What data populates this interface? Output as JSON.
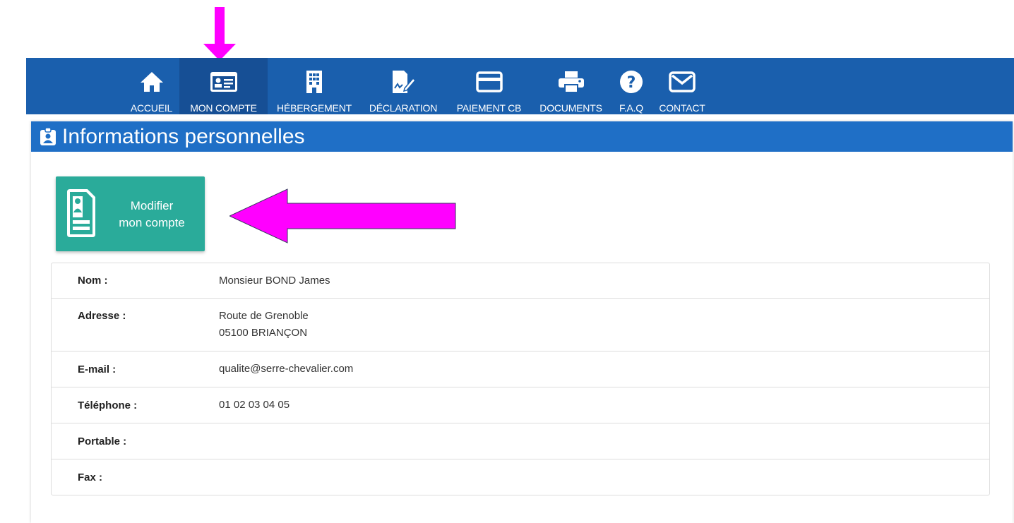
{
  "nav": {
    "items": [
      {
        "label": "ACCUEIL",
        "icon": "home-icon"
      },
      {
        "label": "MON COMPTE",
        "icon": "id-card-icon",
        "active": true
      },
      {
        "label": "HÉBERGEMENT",
        "icon": "building-icon"
      },
      {
        "label": "DÉCLARATION",
        "icon": "signature-icon"
      },
      {
        "label": "PAIEMENT CB",
        "icon": "credit-card-icon"
      },
      {
        "label": "DOCUMENTS",
        "icon": "printer-icon"
      },
      {
        "label": "F.A.Q",
        "icon": "question-icon"
      },
      {
        "label": "CONTACT",
        "icon": "envelope-icon"
      }
    ]
  },
  "panel": {
    "title": "Informations personnelles",
    "modify_button": {
      "line1": "Modifier",
      "line2": "mon compte"
    }
  },
  "info": {
    "rows": [
      {
        "label": "Nom :",
        "lines": [
          "Monsieur BOND James"
        ]
      },
      {
        "label": "Adresse :",
        "lines": [
          "Route de Grenoble",
          "05100 BRIANÇON"
        ]
      },
      {
        "label": "E-mail :",
        "lines": [
          "qualite@serre-chevalier.com"
        ]
      },
      {
        "label": "Téléphone :",
        "lines": [
          "01 02 03 04 05"
        ]
      },
      {
        "label": "Portable :",
        "lines": [
          ""
        ]
      },
      {
        "label": "Fax :",
        "lines": [
          ""
        ]
      }
    ]
  },
  "colors": {
    "navbar": "#1a5fad",
    "nav_active": "#164f95",
    "panel_heading": "#1f6fc6",
    "button": "#2aab9a",
    "annotation_arrow": "#ff00ff"
  }
}
